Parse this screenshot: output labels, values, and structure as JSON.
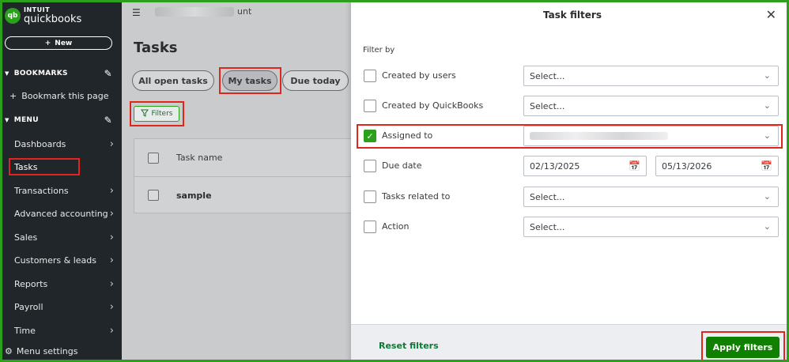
{
  "logo": {
    "intuit": "INTUIT",
    "product": "quickbooks",
    "badge": "qb"
  },
  "sidebar": {
    "new_label": "New",
    "bookmarks_heading": "BOOKMARKS",
    "bookmark_item": "Bookmark this page",
    "menu_heading": "MENU",
    "items": [
      {
        "label": "Dashboards",
        "chevron": true
      },
      {
        "label": "Tasks",
        "chevron": false,
        "active": true
      },
      {
        "label": "Transactions",
        "chevron": true
      },
      {
        "label": "Advanced accounting",
        "chevron": true
      },
      {
        "label": "Sales",
        "chevron": true
      },
      {
        "label": "Customers & leads",
        "chevron": true
      },
      {
        "label": "Reports",
        "chevron": true
      },
      {
        "label": "Payroll",
        "chevron": true
      },
      {
        "label": "Time",
        "chevron": true
      }
    ],
    "menu_settings": "Menu settings"
  },
  "topbar": {
    "company_suffix": "unt"
  },
  "main": {
    "title": "Tasks",
    "tabs": [
      "All open tasks",
      "My tasks",
      "Due today"
    ],
    "filters_label": "Filters",
    "table": {
      "header": "Task name",
      "rows": [
        "sample"
      ]
    }
  },
  "drawer": {
    "title": "Task filters",
    "filter_by": "Filter by",
    "rows": [
      {
        "label": "Created by users",
        "checked": false,
        "value": "Select..."
      },
      {
        "label": "Created by QuickBooks",
        "checked": false,
        "value": "Select..."
      },
      {
        "label": "Assigned to",
        "checked": true,
        "value": ""
      },
      {
        "label": "Due date",
        "checked": false,
        "from": "02/13/2025",
        "to": "05/13/2026"
      },
      {
        "label": "Tasks related to",
        "checked": false,
        "value": "Select..."
      },
      {
        "label": "Action",
        "checked": false,
        "value": "Select..."
      }
    ],
    "reset_label": "Reset filters",
    "apply_label": "Apply filters"
  },
  "colors": {
    "brand_green": "#2ca01c",
    "apply_green": "#108000",
    "highlight_red": "#e0261b",
    "sidebar_bg": "#21262a"
  }
}
